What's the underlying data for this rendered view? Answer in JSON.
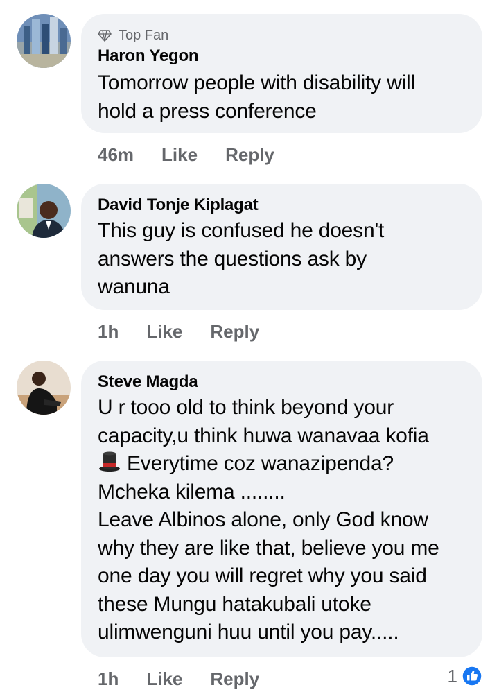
{
  "comments": [
    {
      "badge": "Top Fan",
      "author": "Haron Yegon",
      "lines": [
        "Tomorrow people with disability will",
        "hold a press conference"
      ],
      "time": "46m",
      "like_label": "Like",
      "reply_label": "Reply"
    },
    {
      "author": "David Tonje Kiplagat",
      "lines": [
        "This guy is confused he doesn't",
        "answers the questions ask by",
        "wanuna"
      ],
      "time": "1h",
      "like_label": "Like",
      "reply_label": "Reply"
    },
    {
      "author": "Steve Magda",
      "lines": [
        "U r tooo old to think beyond your",
        "capacity,u think huwa wanavaa kofia",
        "Everytime coz wanazipenda?",
        "Mcheka kilema ........",
        "Leave Albinos alone, only God know",
        "why they are like that, believe you me",
        "one day you will regret why you said",
        "these Mungu hatakubali utoke",
        "ulimwenguni huu until you pay....."
      ],
      "emoji_line_icon": "top-hat-emoji",
      "time": "1h",
      "like_label": "Like",
      "reply_label": "Reply",
      "reaction_count": "1",
      "reaction_icon": "like-reaction-icon"
    }
  ],
  "colors": {
    "bubble": "#f0f2f5",
    "secondary_text": "#65676b",
    "like_blue": "#1877f2"
  }
}
